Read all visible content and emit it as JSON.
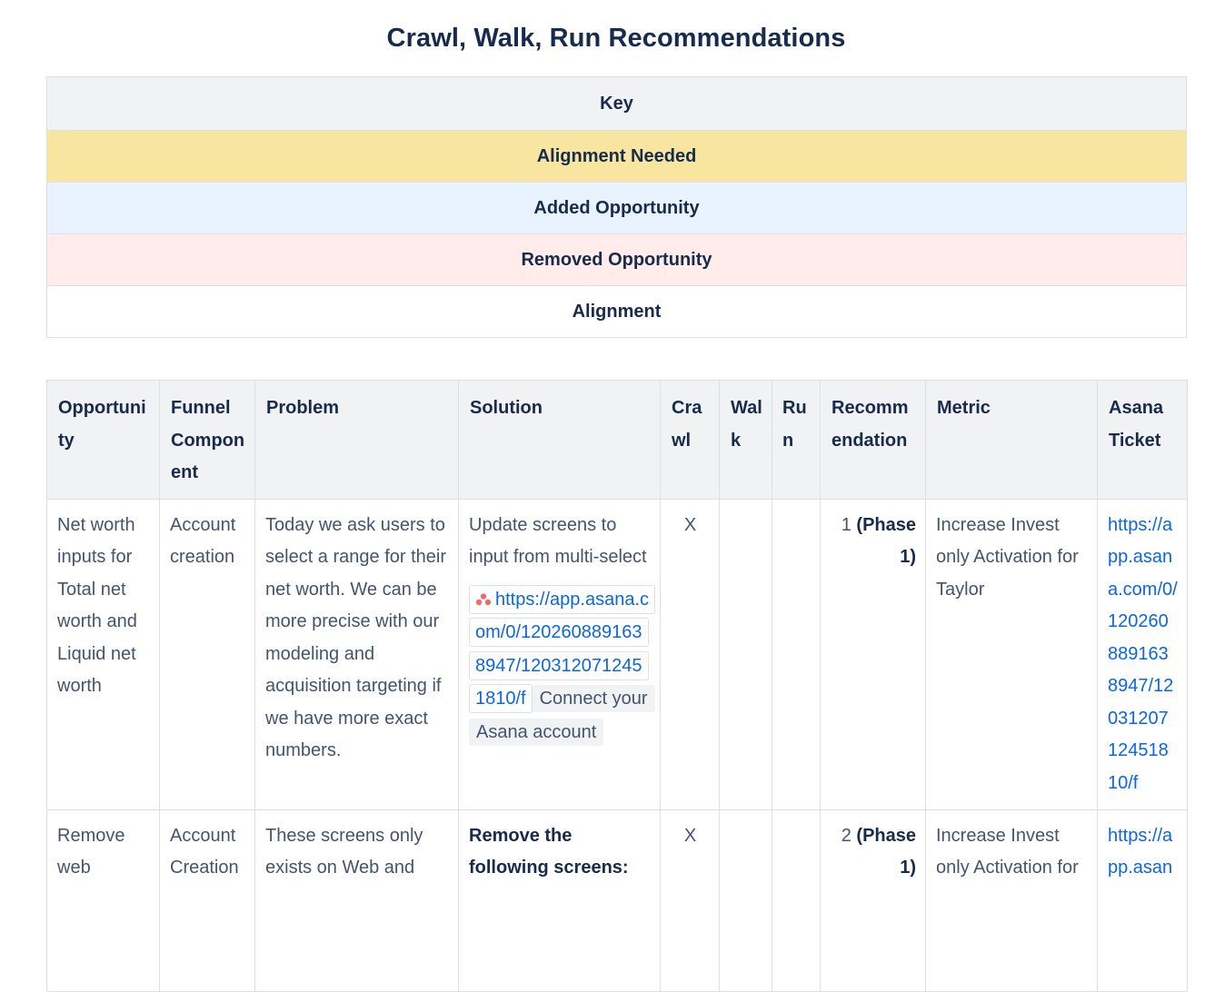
{
  "page_title": "Crawl, Walk, Run Recommendations",
  "key": {
    "rows": [
      "Key",
      "Alignment Needed",
      "Added Opportunity",
      "Removed Opportunity",
      "Alignment"
    ],
    "colors": {
      "header": "#f1f2f4",
      "alignment_needed": "#f8e6a0",
      "added_opportunity": "#e9f2ff",
      "removed_opportunity": "#ffeceb",
      "alignment": "#ffffff"
    }
  },
  "table": {
    "headers": [
      "Opportunity",
      "Funnel Component",
      "Problem",
      "Solution",
      "Crawl",
      "Walk",
      "Run",
      "Recommendation",
      "Metric",
      "Asana Ticket"
    ],
    "rows": [
      {
        "opportunity": "Net worth inputs for Total net worth and Liquid net worth",
        "funnel": "Account creation",
        "problem": "Today we ask users to select a range for their net worth. We can be more precise with our modeling and acquisition targeting if we have more exact numbers.",
        "solution": {
          "text": "Update screens to input from multi-select",
          "smart_link": "https://app.asana.com/0/1202608891638947/1203120712451810/f",
          "connect_label": "Connect your Asana account",
          "icon": "asana-icon"
        },
        "crawl": "X",
        "walk": "",
        "run": "",
        "rec_number": "1",
        "rec_phase": "(Phase 1)",
        "metric": "Increase Invest only Activation for Taylor",
        "asana": "https://app.asana.com/0/1202608891638947/1203120712451810/f"
      },
      {
        "opportunity": "Remove web",
        "funnel": "Account Creation",
        "problem": "These screens only exists on Web and",
        "solution": {
          "text": "Remove the following screens:"
        },
        "crawl": "X",
        "walk": "",
        "run": "",
        "rec_number": "2",
        "rec_phase": "(Phase 1)",
        "metric": "Increase Invest only Activation for",
        "asana": "https://app.asan"
      }
    ]
  }
}
